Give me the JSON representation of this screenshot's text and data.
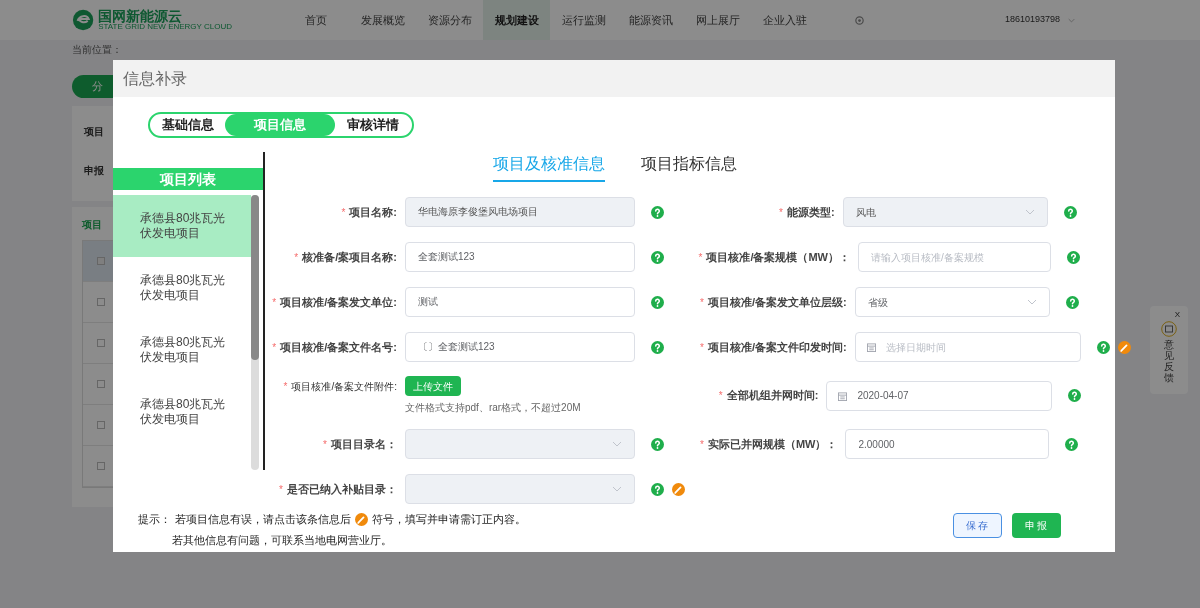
{
  "header": {
    "logo": {
      "name": "国网新能源云",
      "subtitle": "STATE GRID NEW ENERGY CLOUD"
    },
    "nav": [
      {
        "label": "首页",
        "selected": false
      },
      {
        "label": "发展概览",
        "selected": false
      },
      {
        "label": "资源分布",
        "selected": false
      },
      {
        "label": "规划建设",
        "selected": true
      },
      {
        "label": "运行监测",
        "selected": false
      },
      {
        "label": "能源资讯",
        "selected": false
      },
      {
        "label": "网上展厅",
        "selected": false
      },
      {
        "label": "企业入驻",
        "selected": false
      }
    ],
    "user": "18610193798"
  },
  "background": {
    "breadcrumb": "当前位置：",
    "button": "分",
    "labels": [
      "项目",
      "申报"
    ],
    "table_title": "项目",
    "table_rows": [
      {
        "checked": false
      },
      {
        "checked": false
      },
      {
        "checked": false
      },
      {
        "checked": false
      },
      {
        "checked": false
      },
      {
        "checked": false
      }
    ]
  },
  "feedback": {
    "close": "X",
    "label": "意见反馈"
  },
  "dialog": {
    "title": "信息补录",
    "steps": [
      {
        "label": "基础信息",
        "selected": false
      },
      {
        "label": "项目信息",
        "selected": true
      },
      {
        "label": "审核详情",
        "selected": false
      }
    ],
    "project_list": {
      "title": "项目列表",
      "items": [
        {
          "name": "承德县80兆瓦光伏发电项目",
          "selected": true
        },
        {
          "name": "承德县80兆瓦光伏发电项目",
          "selected": false
        },
        {
          "name": "承德县80兆瓦光伏发电项目",
          "selected": false
        },
        {
          "name": "承德县80兆瓦光伏发电项目",
          "selected": false
        }
      ]
    },
    "sections": [
      {
        "label": "项目及核准信息",
        "selected": true
      },
      {
        "label": "项目指标信息",
        "selected": false
      }
    ],
    "form_rows": [
      [
        {
          "kind": "input",
          "label": "项目名称:",
          "mark": "*",
          "value": "华电海原李俊堡风电场项目",
          "disabled": true,
          "help": true,
          "correction": false
        },
        {
          "kind": "select",
          "label": "能源类型:",
          "mark": "*",
          "value": "风电",
          "disabled": true,
          "help": true,
          "correction": false
        }
      ],
      [
        {
          "kind": "input",
          "label": "核准备/案项目名称:",
          "mark": "*",
          "value": "全套测试123",
          "disabled": false,
          "help": true,
          "correction": false
        },
        {
          "kind": "input",
          "label": "项目核准/备案规模（MW）：",
          "mark": "*",
          "placeholder": "请输入项目核准/备案规模",
          "disabled": false,
          "help": true,
          "correction": false
        }
      ],
      [
        {
          "kind": "input",
          "label": "项目核准/备案发文单位:",
          "mark": "*",
          "value": "测试",
          "disabled": false,
          "help": true,
          "correction": false
        },
        {
          "kind": "select",
          "label": "项目核准/备案发文单位层级:",
          "mark": "*",
          "value": "省级",
          "disabled": false,
          "help": true,
          "correction": false
        }
      ],
      [
        {
          "kind": "input",
          "label": "项目核准/备案文件名号:",
          "mark": "*",
          "value": "〔〕全套测试123",
          "disabled": false,
          "help": true,
          "correction": false
        },
        {
          "kind": "date",
          "label": "项目核准/备案文件印发时间:",
          "mark": "*",
          "placeholder": "选择日期时间",
          "disabled": false,
          "help": true,
          "correction": true
        }
      ],
      [
        {
          "kind": "upload",
          "label": "项目核准/备案文件附件:",
          "mark": "*",
          "button": "上传文件",
          "hint": "文件格式支持pdf、rar格式，不超过20M"
        },
        {
          "kind": "date",
          "label": "全部机组并网时间:",
          "mark": "*",
          "value": "2020-04-07",
          "disabled": false,
          "help": true,
          "correction": false
        }
      ],
      [
        {
          "kind": "select",
          "label": "项目目录名：",
          "mark": "*",
          "disabled": true,
          "help": true,
          "correction": false
        },
        {
          "kind": "input",
          "label": "实际已并网规模（MW）：",
          "mark": "*",
          "value": "2.00000",
          "disabled": false,
          "help": true,
          "correction": false
        }
      ],
      [
        {
          "kind": "select",
          "label": "是否已纳入补贴目录：",
          "mark": "*",
          "disabled": true,
          "help": true,
          "correction": true
        }
      ]
    ],
    "tip": {
      "label": "提示：",
      "line1_before": "若项目信息有误，请点击该条信息后",
      "line1_after": "符号，填写并申请需订正内容。",
      "line2": "若其他信息有问题，可联系当地电网营业厅。"
    },
    "buttons": [
      {
        "label": "保存",
        "kind": "secondary"
      },
      {
        "label": "申报",
        "kind": "primary"
      }
    ]
  }
}
